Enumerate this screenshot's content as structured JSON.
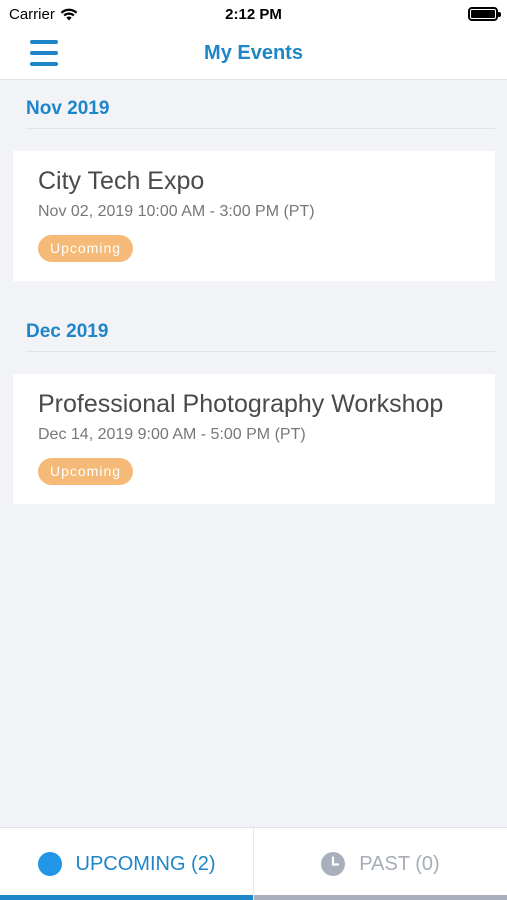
{
  "status_bar": {
    "carrier": "Carrier",
    "time": "2:12 PM",
    "battery_level": 1.0
  },
  "nav": {
    "title": "My Events",
    "menu_icon": "hamburger-menu-icon"
  },
  "sections": [
    {
      "month": "Nov 2019",
      "events": [
        {
          "title": "City Tech Expo",
          "time": "Nov 02, 2019 10:00 AM - 3:00 PM (PT)",
          "status": "Upcoming"
        }
      ]
    },
    {
      "month": "Dec 2019",
      "events": [
        {
          "title": "Professional Photography Workshop",
          "time": "Dec 14, 2019 9:00 AM - 5:00 PM (PT)",
          "status": "Upcoming"
        }
      ]
    }
  ],
  "tabs": {
    "upcoming": {
      "label": "UPCOMING (2)",
      "icon": "dot-icon",
      "active": true
    },
    "past": {
      "label": "PAST (0)",
      "icon": "clock-icon",
      "active": false
    }
  },
  "colors": {
    "accent": "#1e86c8",
    "badge": "#f5b978",
    "background": "#f1f3f7"
  }
}
